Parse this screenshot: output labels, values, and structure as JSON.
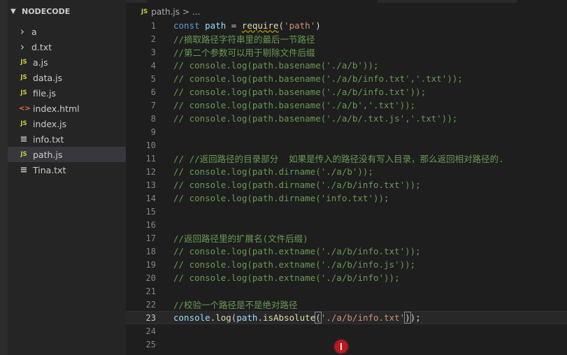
{
  "explorer": {
    "title": "NODECODE",
    "items": [
      {
        "label": "a",
        "kind": "folder",
        "icon": "chevron-right-icon"
      },
      {
        "label": "d.txt",
        "kind": "folder",
        "icon": "chevron-right-icon"
      },
      {
        "label": "a.js",
        "kind": "js",
        "icon": "js-file-icon"
      },
      {
        "label": "data.js",
        "kind": "js",
        "icon": "js-file-icon"
      },
      {
        "label": "file.js",
        "kind": "js",
        "icon": "js-file-icon"
      },
      {
        "label": "index.html",
        "kind": "html",
        "icon": "html-file-icon"
      },
      {
        "label": "index.js",
        "kind": "js",
        "icon": "js-file-icon"
      },
      {
        "label": "info.txt",
        "kind": "txt",
        "icon": "text-file-icon"
      },
      {
        "label": "path.js",
        "kind": "js",
        "icon": "js-file-icon",
        "selected": true
      },
      {
        "label": "Tina.txt",
        "kind": "txt",
        "icon": "text-file-icon"
      }
    ]
  },
  "breadcrumb": {
    "file_icon": "JS",
    "file": "path.js",
    "separator": ">",
    "tail": "..."
  },
  "editor": {
    "current_line": 23,
    "lines": [
      {
        "n": "1",
        "segs": [
          [
            "kw",
            "const "
          ],
          [
            "var",
            "path"
          ],
          [
            "op",
            " = "
          ],
          [
            "fn",
            "require"
          ],
          [
            "op",
            "("
          ],
          [
            "str",
            "'path'"
          ],
          [
            "op",
            ")"
          ]
        ]
      },
      {
        "n": "2",
        "segs": [
          [
            "cmt",
            "//摘取路径字符串里的最后一节路径"
          ]
        ]
      },
      {
        "n": "3",
        "segs": [
          [
            "cmt",
            "//第二个参数可以用于剔除文件后缀"
          ]
        ]
      },
      {
        "n": "4",
        "segs": [
          [
            "cmt",
            "// console.log(path.basename('./a/b'));"
          ]
        ]
      },
      {
        "n": "5",
        "segs": [
          [
            "cmt",
            "// console.log(path.basename('./a/b/info.txt','.txt'));"
          ]
        ]
      },
      {
        "n": "6",
        "segs": [
          [
            "cmt",
            "// console.log(path.basename('./a/b/info.txt'));"
          ]
        ]
      },
      {
        "n": "7",
        "segs": [
          [
            "cmt",
            "// console.log(path.basename('./a/b','.txt'));"
          ]
        ]
      },
      {
        "n": "8",
        "segs": [
          [
            "cmt",
            "// console.log(path.basename('./a/b/.txt.js','.txt'));"
          ]
        ]
      },
      {
        "n": "9",
        "segs": []
      },
      {
        "n": "10",
        "segs": []
      },
      {
        "n": "11",
        "segs": [
          [
            "cmt",
            "// //返回路径的目录部分  如果是传入的路径没有写入目录，那么返回相对路径的."
          ]
        ]
      },
      {
        "n": "12",
        "segs": [
          [
            "cmt",
            "// console.log(path.dirname('./a/b'));"
          ]
        ]
      },
      {
        "n": "13",
        "segs": [
          [
            "cmt",
            "// console.log(path.dirname('./a/b/info.txt'));"
          ]
        ]
      },
      {
        "n": "14",
        "segs": [
          [
            "cmt",
            "// console.log(path.dirname('info.txt'));"
          ]
        ]
      },
      {
        "n": "15",
        "segs": []
      },
      {
        "n": "16",
        "segs": []
      },
      {
        "n": "17",
        "segs": [
          [
            "cmt",
            "//返回路径里的扩展名(文件后缀)"
          ]
        ]
      },
      {
        "n": "18",
        "segs": [
          [
            "cmt",
            "// console.log(path.extname('./a/b/info.txt'));"
          ]
        ]
      },
      {
        "n": "19",
        "segs": [
          [
            "cmt",
            "// console.log(path.extname('./a/b/info.js'));"
          ]
        ]
      },
      {
        "n": "20",
        "segs": [
          [
            "cmt",
            "// console.log(path.extname('./a/b/info'));"
          ]
        ]
      },
      {
        "n": "21",
        "segs": []
      },
      {
        "n": "22",
        "segs": [
          [
            "cmt",
            "//校验一个路径是不是绝对路径"
          ]
        ]
      },
      {
        "n": "23",
        "segs": [
          [
            "var",
            "console"
          ],
          [
            "op",
            "."
          ],
          [
            "fn",
            "log"
          ],
          [
            "op",
            "("
          ],
          [
            "var",
            "path"
          ],
          [
            "op",
            "."
          ],
          [
            "fn",
            "isAbsolute"
          ],
          [
            "op",
            "("
          ],
          [
            "str",
            "'./a/b/info.txt'"
          ],
          [
            "op",
            ")"
          ],
          [
            "op",
            ");"
          ]
        ]
      },
      {
        "n": "24",
        "segs": []
      },
      {
        "n": "25",
        "segs": []
      }
    ]
  },
  "colors": {
    "keyword": "#569cd6",
    "variable": "#9cdcfe",
    "function": "#dcdcaa",
    "string": "#ce9178",
    "comment": "#6a9955",
    "cursor": "#c4151c"
  }
}
